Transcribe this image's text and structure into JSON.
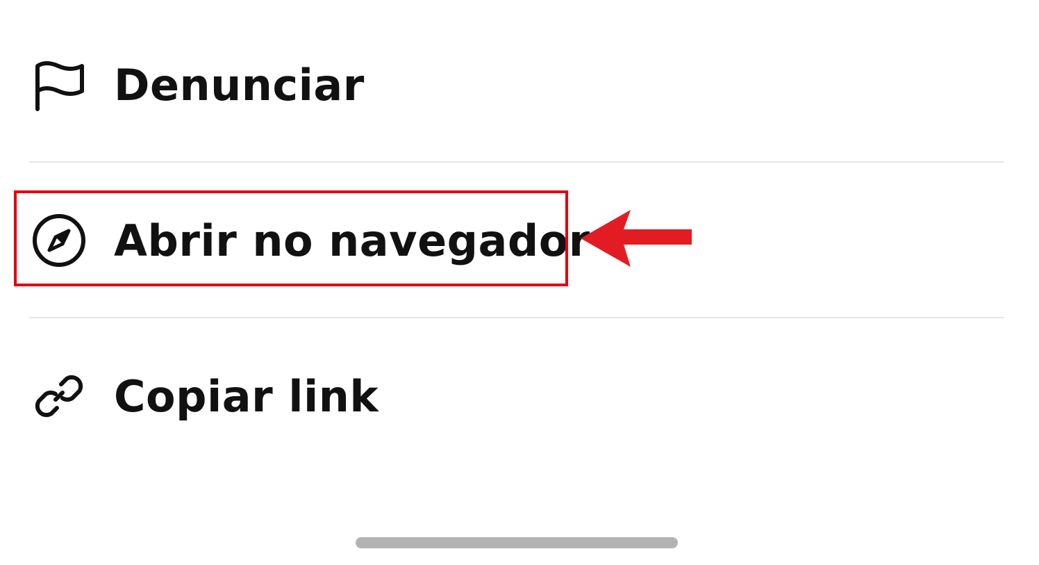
{
  "menu": {
    "items": [
      {
        "label": "Denunciar",
        "icon": "flag-icon"
      },
      {
        "label": "Abrir no navegador",
        "icon": "compass-icon"
      },
      {
        "label": "Copiar link",
        "icon": "link-icon"
      }
    ]
  },
  "annotation": {
    "highlight_color": "#e3000f",
    "arrow_color": "#e31c24"
  }
}
